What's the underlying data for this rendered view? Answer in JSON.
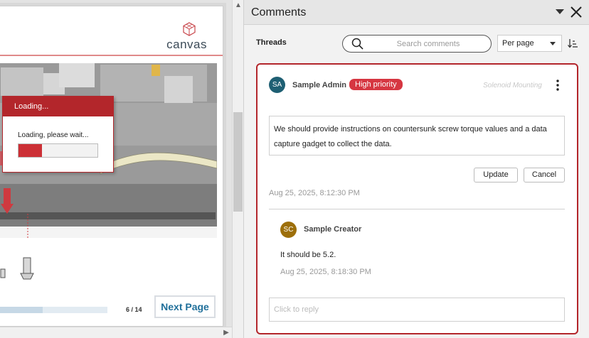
{
  "viewer": {
    "logo_text": "canvas",
    "loading": {
      "title": "Loading...",
      "message": "Loading, please wait...",
      "progress": 0.3
    },
    "page_counter": "6 / 14",
    "page_progress": 0.43,
    "next_page_label": "Next Page"
  },
  "panel": {
    "title": "Comments",
    "threads_label": "Threads",
    "search_placeholder": "Search comments",
    "per_page_label": "Per page"
  },
  "thread": {
    "author_initials": "SA",
    "author": "Sample Admin",
    "priority": "High priority",
    "context": "Solenoid Mounting",
    "body": "We should provide instructions on countersunk screw torque values and a data capture gadget to collect the data.",
    "update_label": "Update",
    "cancel_label": "Cancel",
    "timestamp": "Aug 25, 2025, 8:12:30 PM",
    "reply": {
      "author_initials": "SC",
      "author": "Sample Creator",
      "body": "It should be 5.2.",
      "timestamp": "Aug 25, 2025, 8:18:30 PM"
    },
    "reply_placeholder": "Click to reply"
  },
  "colors": {
    "accent": "#b3262b",
    "priority_badge": "#d63641",
    "avatar_sa": "#1e5f73",
    "avatar_sc": "#9d6f0a",
    "link": "#1f6f9a"
  }
}
